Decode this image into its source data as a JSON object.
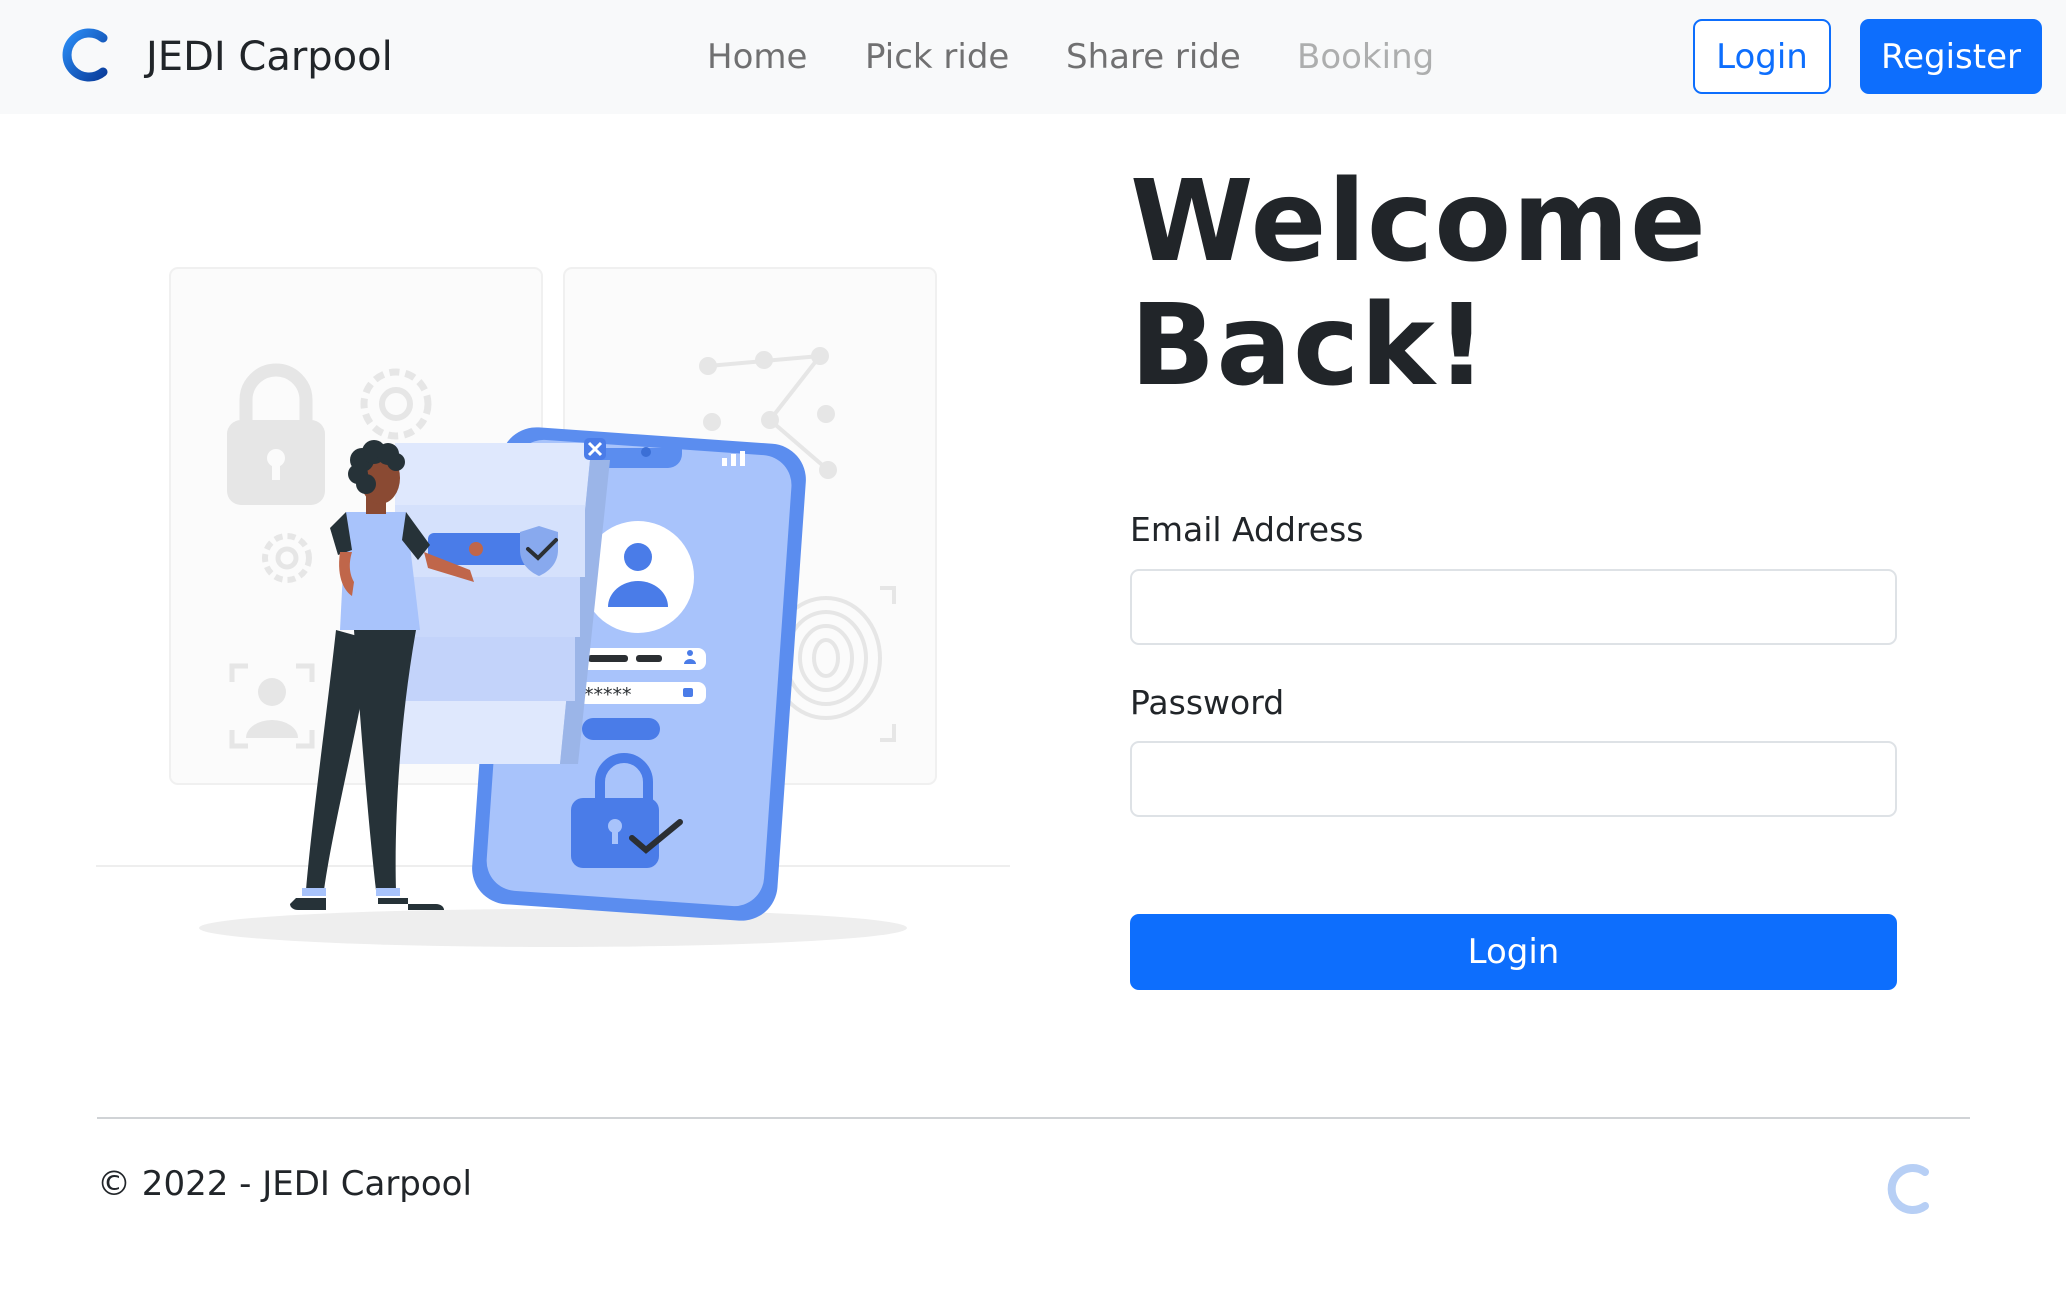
{
  "navbar": {
    "brand_name": "JEDI Carpool",
    "logo_icon": "carpool-c-logo-icon",
    "links": [
      {
        "label": "Home",
        "state": "normal"
      },
      {
        "label": "Pick ride",
        "state": "normal"
      },
      {
        "label": "Share ride",
        "state": "normal"
      },
      {
        "label": "Booking",
        "state": "disabled"
      }
    ],
    "login_label": "Login",
    "register_label": "Register"
  },
  "illustration": {
    "icon": "secure-login-illustration-icon",
    "phone_password_mask": "*****"
  },
  "form": {
    "heading": "Welcome Back!",
    "email_label": "Email Address",
    "email_value": "",
    "password_label": "Password",
    "password_value": "",
    "submit_label": "Login"
  },
  "footer": {
    "copyright": "© 2022 - JEDI Carpool",
    "logo_icon": "carpool-c-logo-icon"
  },
  "colors": {
    "primary": "#0d6efd",
    "navbar_bg": "#f8f9fa",
    "text": "#212529",
    "illustration_blue": "#5b8def"
  }
}
